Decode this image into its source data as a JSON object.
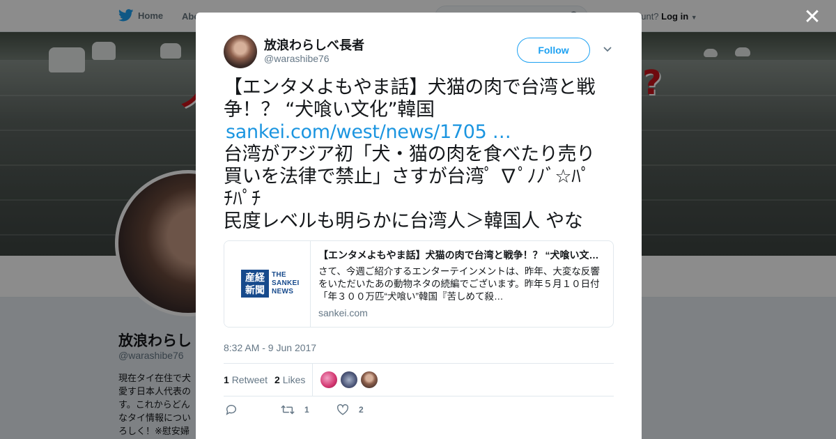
{
  "background": {
    "nav": {
      "home_label": "Home",
      "about_label": "Abo",
      "account_prompt": "ccount?",
      "login_label": "Log in"
    },
    "banner_text_left": "ノ",
    "banner_text_right": "?",
    "profile": {
      "name": "放浪わらし",
      "handle": "@warashibe76",
      "bio_lines": [
        "現在タイ在住で犬",
        "愛す日本人代表の",
        "す。これからどん",
        "なタイ情報につい",
        "ろしく！※慰安婦"
      ]
    }
  },
  "close_label": "✕",
  "tweet": {
    "user": {
      "name": "放浪わらしべ長者",
      "handle": "@warashibe76"
    },
    "follow_label": "Follow",
    "text_lines": [
      "【エンタメよもやま話】犬猫の肉で台湾と戦",
      "争！？ “犬喰い文化”韓国",
      "台湾がアジア初「犬・猫の肉を食べたり売り",
      "買いを法律で禁止」さすが台湾ﾟ ∇ﾟﾉﾉﾞ☆ﾊﾟ",
      "ﾁﾊﾟﾁ",
      "民度レベルも明らかに台湾人＞韓国人 やな"
    ],
    "link_text": "sankei.com/west/news/1705 …",
    "card": {
      "logo_glyphs": "産経新聞",
      "logo_text": [
        "THE",
        "SANKEI",
        "NEWS"
      ],
      "title": "【エンタメよもやま話】犬猫の肉で台湾と戦争！？ “犬喰い文化”韓国",
      "description": "さて、今週ご紹介するエンターテインメントは、昨年、大変な反響をいただいたあの動物ネタの続編でございます。昨年５月１０日付「年３００万匹“犬喰い”韓国『苦しめて殺…",
      "domain": "sankei.com"
    },
    "timestamp": "8:32 AM - 9 Jun 2017",
    "stats": {
      "retweets_count": "1",
      "retweets_label": "Retweet",
      "likes_count": "2",
      "likes_label": "Likes"
    },
    "actions": {
      "retweet_count": "1",
      "like_count": "2"
    }
  },
  "colors": {
    "accent": "#1da1f2",
    "link": "#1b95e0",
    "text": "#14171a",
    "muted": "#657786",
    "like_icon": "#657786"
  },
  "icons": [
    "twitter-bird-icon",
    "search-icon",
    "close-icon",
    "chevron-down-icon",
    "reply-icon",
    "retweet-icon",
    "heart-icon"
  ]
}
